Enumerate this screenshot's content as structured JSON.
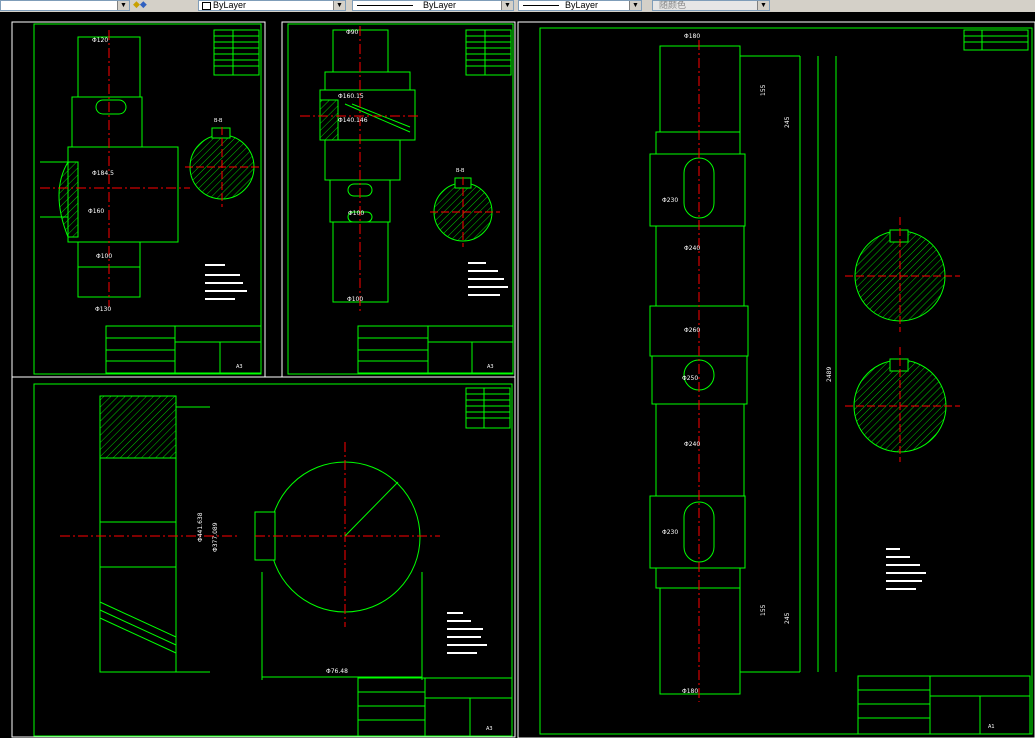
{
  "toolbar": {
    "linetype_label": "ByLayer",
    "color_label": "ByLayer",
    "lineweight_label": "ByLayer",
    "plotstyle_label": "ByLayer",
    "plotstyle_right_label": "随颜色"
  },
  "colors": {
    "background": "#000000",
    "frame": "#00ff00",
    "centerline": "#ff0000",
    "text": "#ffffff",
    "dimension": "#00ff00",
    "toolbar_bg": "#d4d0c8"
  },
  "sheets": {
    "sheet1": {
      "dims": [
        "Φ120",
        "Φ184.5",
        "Φ160",
        "Φ100",
        "Φ130"
      ],
      "section_label": "B-B",
      "paper_size": "A3"
    },
    "sheet2": {
      "dims": [
        "Φ90",
        "Φ160.15",
        "Φ140.146",
        "Φ100",
        "Φ100"
      ],
      "section_label": "B-B",
      "paper_size": "A3"
    },
    "sheet3": {
      "dims": [
        "Φ441.638",
        "Φ377.089",
        "Φ76.48"
      ],
      "paper_size": "A3"
    },
    "sheet4": {
      "dims": [
        "Φ180",
        "Φ230",
        "Φ240",
        "Φ260",
        "Φ250",
        "Φ240",
        "Φ230",
        "Φ180"
      ],
      "lengths": [
        "155",
        "245",
        "155",
        "245",
        "2489"
      ],
      "paper_size": "A1"
    }
  }
}
